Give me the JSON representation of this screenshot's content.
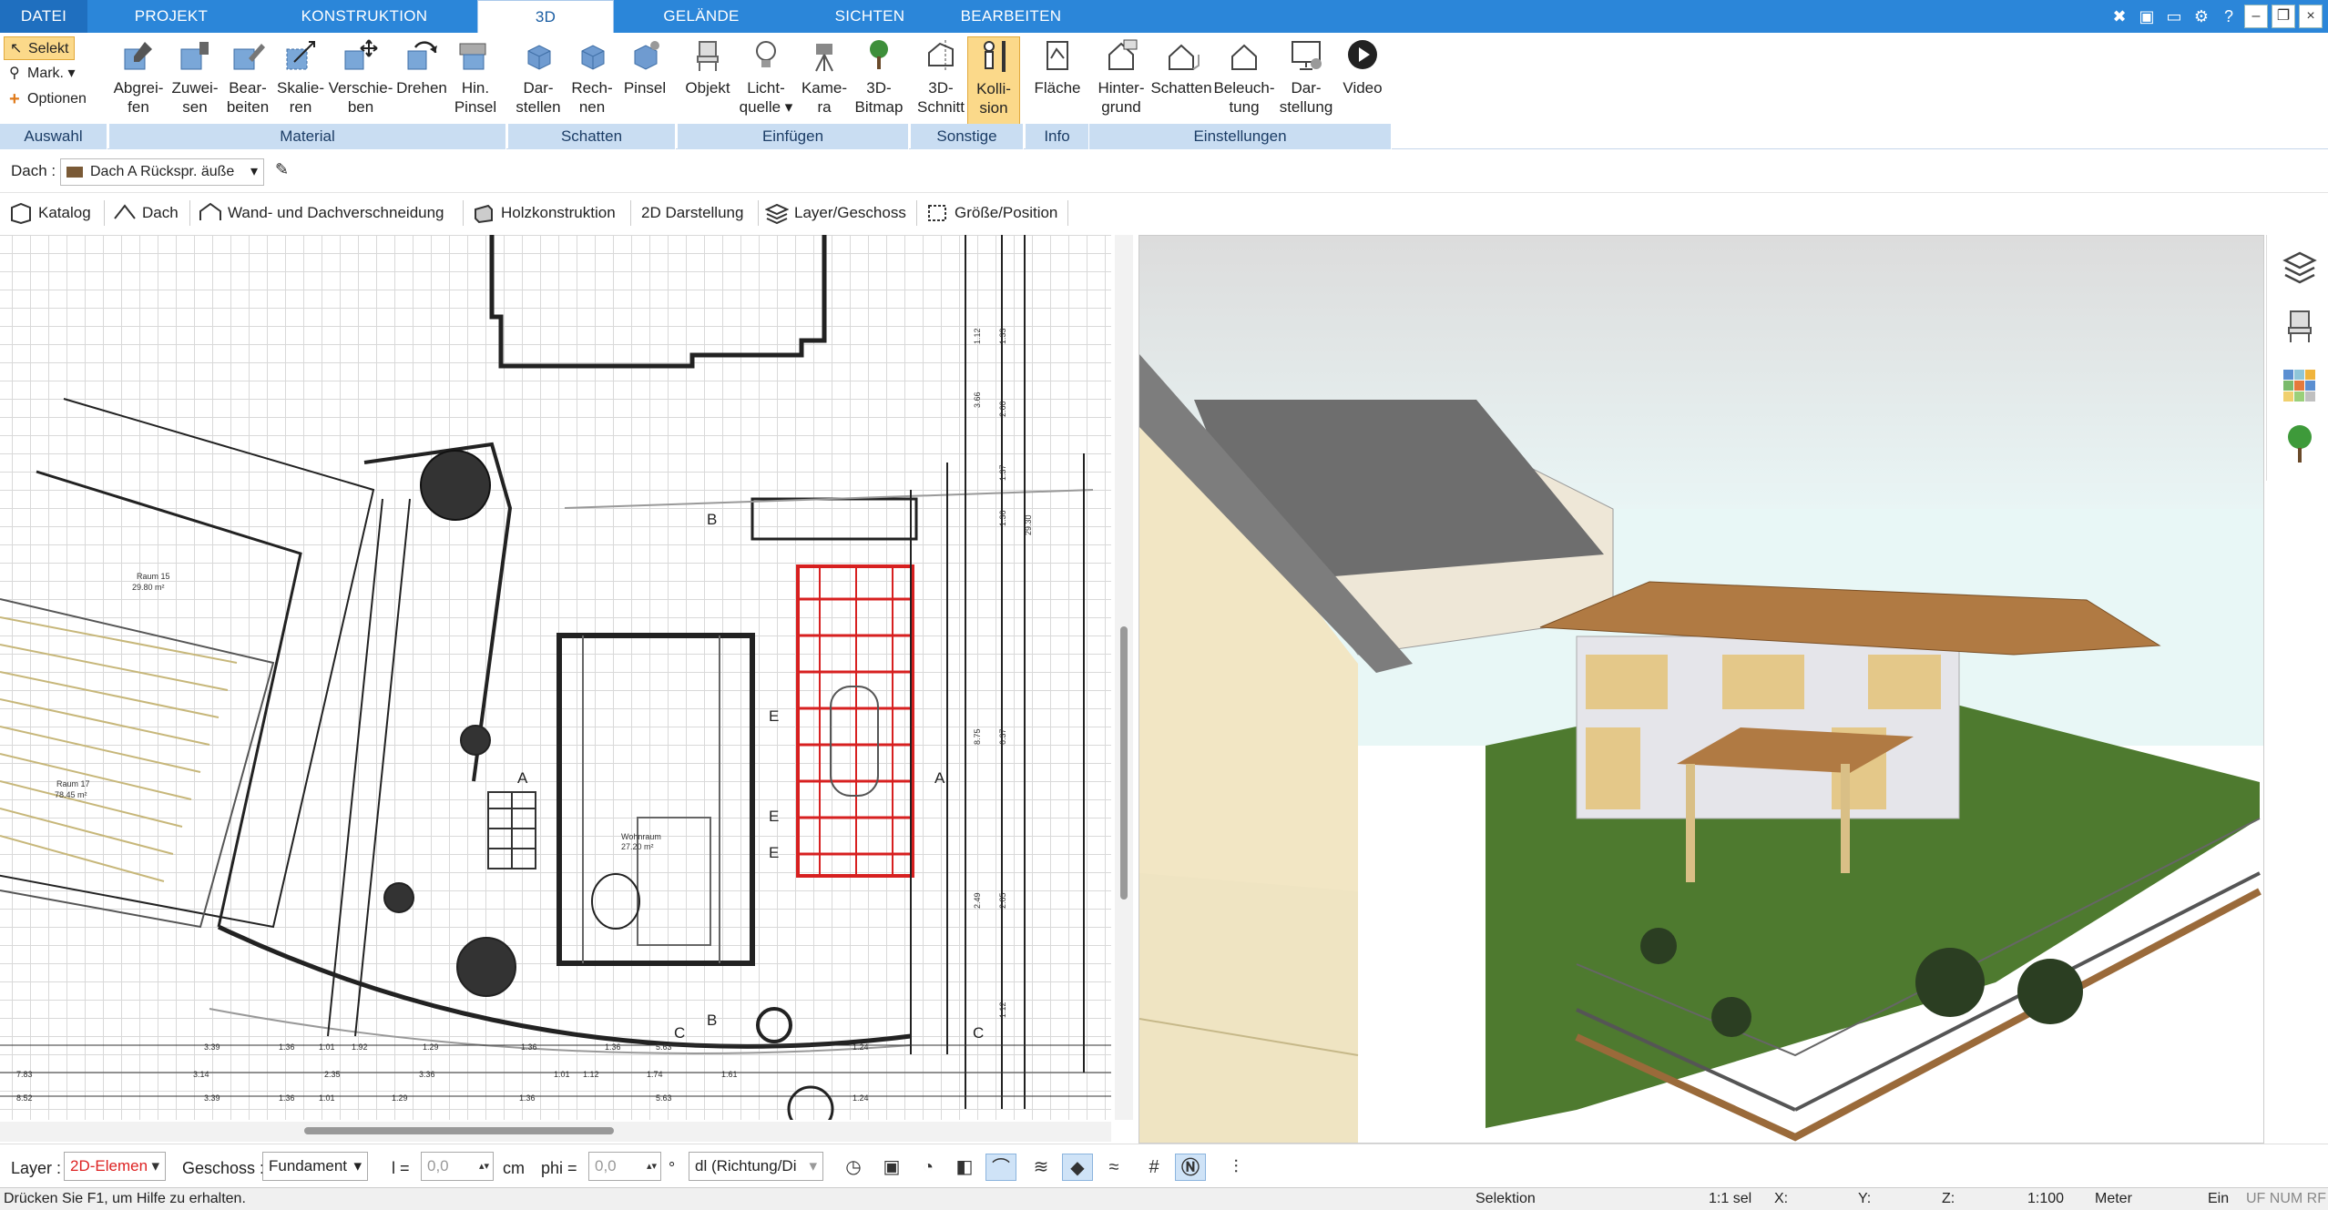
{
  "tabs": [
    "DATEI",
    "PROJEKT",
    "KONSTRUKTION",
    "3D",
    "GELÄNDE",
    "SICHTEN",
    "BEARBEITEN"
  ],
  "active_tab": "3D",
  "auswahl": {
    "selekt": "Selekt",
    "mark": "Mark.",
    "optionen": "Optionen",
    "group": "Auswahl"
  },
  "ribbon": {
    "material": {
      "group": "Material",
      "buttons": [
        [
          "Abgrei-",
          "fen"
        ],
        [
          "Zuwei-",
          "sen"
        ],
        [
          "Bear-",
          "beiten"
        ],
        [
          "Skalie-",
          "ren"
        ],
        [
          "Verschie-",
          "ben"
        ],
        [
          "Drehen",
          ""
        ],
        [
          "Hin.",
          "Pinsel"
        ]
      ]
    },
    "schatten": {
      "group": "Schatten",
      "buttons": [
        [
          "Dar-",
          "stellen"
        ],
        [
          "Rech-",
          "nen"
        ],
        [
          "Pinsel",
          ""
        ]
      ]
    },
    "einfuegen": {
      "group": "Einfügen",
      "buttons": [
        [
          "Objekt",
          ""
        ],
        [
          "Licht-",
          "quelle ▾"
        ],
        [
          "Kame-",
          "ra"
        ],
        [
          "3D-",
          "Bitmap"
        ]
      ]
    },
    "sonstige": {
      "group": "Sonstige",
      "buttons": [
        [
          "3D-",
          "Schnitt"
        ],
        [
          "Kolli-",
          "sion"
        ]
      ]
    },
    "info": {
      "group": "Info",
      "buttons": [
        [
          "Fläche",
          ""
        ]
      ]
    },
    "einstellungen": {
      "group": "Einstellungen",
      "buttons": [
        [
          "Hinter-",
          "grund"
        ],
        [
          "Schatten",
          ""
        ],
        [
          "Beleuch-",
          "tung"
        ],
        [
          "Dar-",
          "stellung"
        ],
        [
          "Video",
          ""
        ]
      ]
    }
  },
  "row2": {
    "label": "Dach :",
    "value": "Dach A Rückspr. äuße"
  },
  "row3": [
    "Katalog",
    "Dach",
    "Wand- und Dachverschneidung",
    "Holzkonstruktion",
    "2D Darstellung",
    "Layer/Geschoss",
    "Größe/Position"
  ],
  "plan": {
    "raum15": "Raum 15",
    "raum15_area": "29.80 m²",
    "raum17": "Raum 17",
    "raum17_area": "78.45 m²",
    "wohnraum": "Wohnraum",
    "wohnraum_area": "27.20 m²",
    "section_labels": [
      "A",
      "A",
      "B",
      "B",
      "C",
      "C",
      "E",
      "E",
      "E"
    ],
    "dims_row1": [
      "3.39",
      "1.36",
      "1.01",
      "1.92",
      "1.29",
      "1.36",
      "1.36",
      "5.63",
      "1.24"
    ],
    "dims_row2": [
      "7.83",
      "3.14",
      "2.35",
      "3.36",
      "1.01",
      "1.12",
      "1.74",
      "1.61"
    ],
    "dims_row3": [
      "8.52",
      "3.39",
      "1.36",
      "1.01",
      "1.29",
      "1.36",
      "5.63",
      "1.24"
    ],
    "dims_vertical": [
      "1.12",
      "1.33",
      "3.66",
      "2.60",
      "1.37",
      "1.36",
      "29.30",
      "8.75",
      "6.37",
      "2.49",
      "2.85",
      "1.12"
    ]
  },
  "bottom": {
    "layer_label": "Layer :",
    "layer_value": "2D-Elemen",
    "geschoss_label": "Geschoss :",
    "geschoss_value": "Fundament",
    "l_label": "l =",
    "l_value": "0,0",
    "l_unit": "cm",
    "phi_label": "phi =",
    "phi_value": "0,0",
    "phi_unit": "°",
    "dl_value": "dl (Richtung/Di"
  },
  "status": {
    "help": "Drücken Sie F1, um Hilfe zu erhalten.",
    "mode": "Selektion",
    "sel": "1:1 sel",
    "x": "X:",
    "y": "Y:",
    "z": "Z:",
    "scale": "1:100",
    "unit": "Meter",
    "ein": "Ein",
    "flags": "UF NUM RF"
  },
  "colors": {
    "tab_bar": "#2b86d9",
    "group_label": "#c9ddf2",
    "active_btn": "#fbd98a",
    "roof": "#b07a43",
    "lawn": "#4e7a2f"
  }
}
